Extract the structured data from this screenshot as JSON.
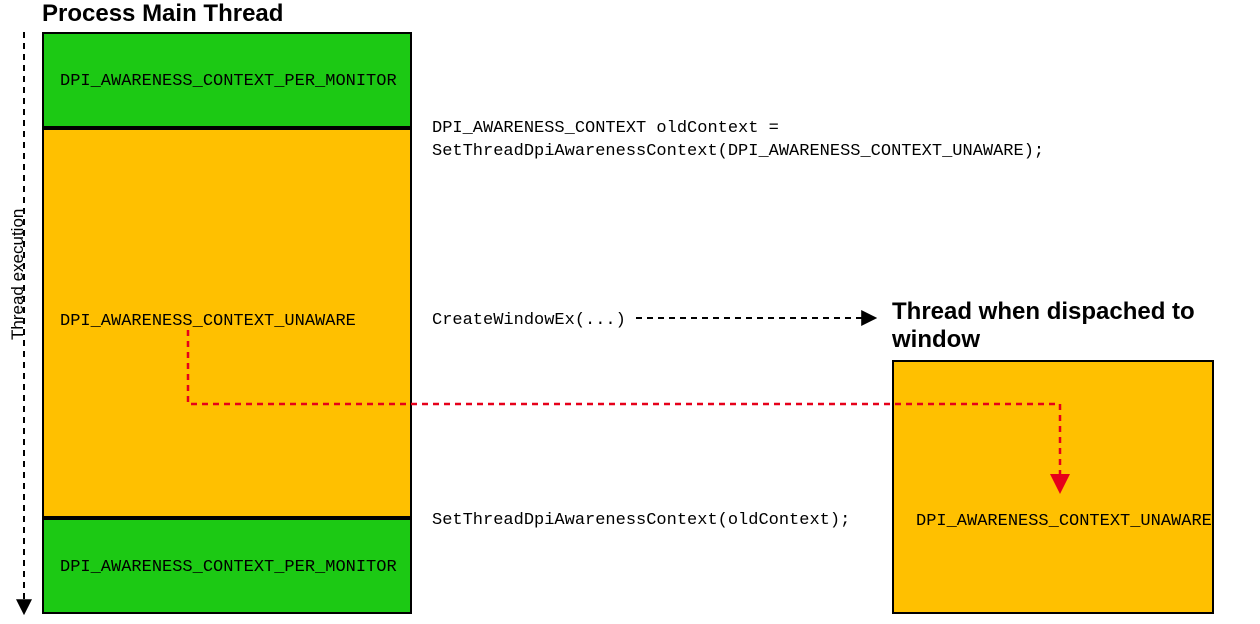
{
  "titles": {
    "main": "Process Main Thread",
    "window": "Thread when dispached to window"
  },
  "axis": {
    "label": "Thread execution"
  },
  "left_stack": {
    "block1": "DPI_AWARENESS_CONTEXT_PER_MONITOR",
    "block2": "DPI_AWARENESS_CONTEXT_UNAWARE",
    "block3": "DPI_AWARENESS_CONTEXT_PER_MONITOR"
  },
  "right_box": {
    "label": "DPI_AWARENESS_CONTEXT_UNAWARE"
  },
  "code": {
    "line1": "DPI_AWARENESS_CONTEXT oldContext =\nSetThreadDpiAwarenessContext(DPI_AWARENESS_CONTEXT_UNAWARE);",
    "line2": "CreateWindowEx(...)",
    "line3": "SetThreadDpiAwarenessContext(oldContext);"
  }
}
